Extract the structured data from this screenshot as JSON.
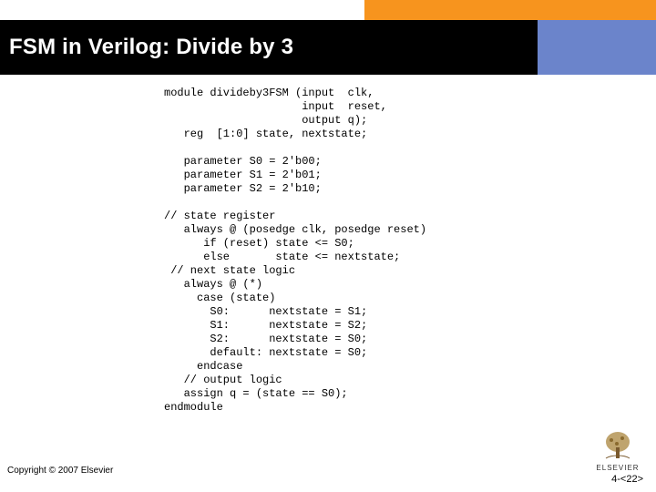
{
  "header": {
    "title": "FSM in Verilog: Divide by 3"
  },
  "code": {
    "lines": [
      "module divideby3FSM (input  clk,",
      "                     input  reset,",
      "                     output q);",
      "   reg  [1:0] state, nextstate;",
      "",
      "   parameter S0 = 2'b00;",
      "   parameter S1 = 2'b01;",
      "   parameter S2 = 2'b10;",
      "",
      "// state register",
      "   always @ (posedge clk, posedge reset)",
      "      if (reset) state <= S0;",
      "      else       state <= nextstate;",
      " // next state logic",
      "   always @ (*)",
      "     case (state)",
      "       S0:      nextstate = S1;",
      "       S1:      nextstate = S2;",
      "       S2:      nextstate = S0;",
      "       default: nextstate = S0;",
      "     endcase",
      "   // output logic",
      "   assign q = (state == S0);",
      "endmodule"
    ]
  },
  "footer": {
    "copyright": "Copyright © 2007 Elsevier",
    "page": "4-<22>",
    "logo_label": "ELSEVIER"
  }
}
